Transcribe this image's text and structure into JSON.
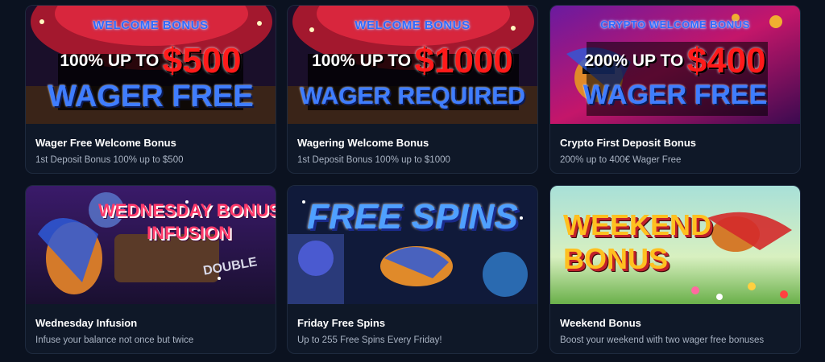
{
  "cards": [
    {
      "banner": {
        "tag": "WELCOME BONUS",
        "pre": "100% UP TO",
        "amount": "$500",
        "main": "WAGER FREE"
      },
      "title": "Wager Free Welcome Bonus",
      "desc": "1st Deposit Bonus 100% up to $500"
    },
    {
      "banner": {
        "tag": "WELCOME BONUS",
        "pre": "100% UP TO",
        "amount": "$1000",
        "main": "WAGER REQUIRED"
      },
      "title": "Wagering Welcome Bonus",
      "desc": "1st Deposit Bonus 100% up to $1000"
    },
    {
      "banner": {
        "tag": "CRYPTO WELCOME BONUS",
        "pre": "200% UP TO",
        "amount": "$400",
        "main": "WAGER FREE"
      },
      "title": "Crypto First Deposit Bonus",
      "desc": "200% up to 400€ Wager Free"
    },
    {
      "banner": {
        "line1": "WEDNESDAY BONUS",
        "line2": "INFUSION",
        "extra": "DOUBLE"
      },
      "title": "Wednesday Infusion",
      "desc": "Infuse your balance not once but twice"
    },
    {
      "banner": {
        "line1": "FREE SPINS"
      },
      "title": "Friday Free Spins",
      "desc": "Up to 255 Free Spins Every Friday!"
    },
    {
      "banner": {
        "line1": "WEEKEND",
        "line2": "BONUS"
      },
      "title": "Weekend Bonus",
      "desc": "Boost your weekend with two wager free bonuses"
    }
  ],
  "colors": {
    "page_bg": "#0b1220",
    "card_bg": "#0f1828",
    "title": "#ffffff",
    "desc": "#a9b3c3",
    "amount_red": "#ff1a1a",
    "wager_blue": "#3f7dff"
  }
}
